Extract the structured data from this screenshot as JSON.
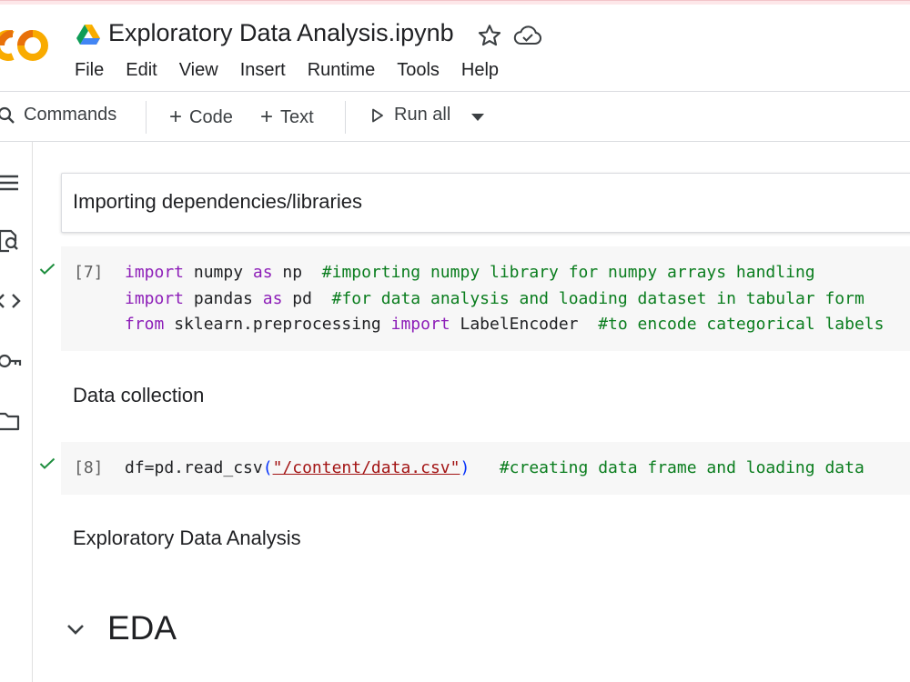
{
  "notebook": {
    "title": "Exploratory Data Analysis.ipynb",
    "logo_text": "CO"
  },
  "menu": [
    "File",
    "Edit",
    "View",
    "Insert",
    "Runtime",
    "Tools",
    "Help"
  ],
  "toolbar": {
    "commands_label": "Commands",
    "code_label": "Code",
    "text_label": "Text",
    "run_all_label": "Run all"
  },
  "cells": {
    "heading1": "Importing dependencies/libraries",
    "cell7": {
      "exec_count": "[7]",
      "line1": {
        "kw1": "import",
        "mid1": " numpy ",
        "kw2": "as",
        "mid2": " np  ",
        "comment": "#importing numpy library for numpy arrays handling"
      },
      "line2": {
        "kw1": "import",
        "mid1": " pandas ",
        "kw2": "as",
        "mid2": " pd  ",
        "comment": "#for data analysis and loading dataset in tabular form"
      },
      "line3": {
        "kw1": "from",
        "mid1": " sklearn.preprocessing ",
        "kw2": "import",
        "mid2": " LabelEncoder  ",
        "comment": "#to encode categorical labels"
      }
    },
    "heading2": "Data collection",
    "cell8": {
      "exec_count": "[8]",
      "prefix": "df=pd.read_csv",
      "open_paren": "(",
      "string": "\"/content/data.csv\"",
      "close_paren": ")",
      "spacer": "   ",
      "comment": "#creating data frame and loading data"
    },
    "heading3": "Exploratory Data Analysis",
    "section_title": "EDA"
  },
  "icons": {
    "drive": "google-drive-icon",
    "star": "star-icon",
    "cloud": "cloud-saved-icon",
    "search": "search-icon",
    "run": "play-icon",
    "dropdown": "caret-down-icon",
    "toc": "table-of-contents-icon",
    "find": "find-replace-icon",
    "code_snippets": "code-snippets-icon",
    "secrets": "key-icon",
    "files": "folder-icon",
    "check": "checkmark-icon",
    "collapse": "chevron-down-icon"
  },
  "colors": {
    "keyword": "#8d1eb8",
    "comment": "#0a7d1e",
    "string": "#a31515",
    "check": "#1e8e3e",
    "logo_orange": "#f9ab00",
    "logo_dark_orange": "#e8710a"
  }
}
